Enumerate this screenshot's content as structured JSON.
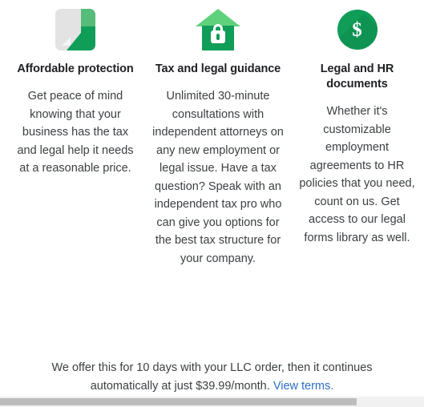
{
  "cards": [
    {
      "icon": "document-folded-corner-icon",
      "title": "Affordable protection",
      "body": "Get peace of mind knowing that your business has the tax and legal help it needs at a reasonable price."
    },
    {
      "icon": "house-with-padlock-icon",
      "title": "Tax and legal guidance",
      "body": "Unlimited 30-minute consultations with independent attorneys on any new employment or legal issue. Have a tax question? Speak with an independent tax pro who can give you options for the best tax structure for your company."
    },
    {
      "icon": "dollar-circle-icon",
      "title": "Legal and HR documents",
      "body": "Whether it's customizable employment agreements to HR policies that you need, count on us. Get access to our legal forms library as well."
    }
  ],
  "footer": {
    "text": "We offer this for 10 days with your LLC order, then it continues automatically at just $39.99/month.",
    "link_label": "View terms.",
    "dollar_glyph": "$"
  },
  "colors": {
    "brand_green": "#0f9d58",
    "light_green": "#5fd17c",
    "link_blue": "#2b6fc3",
    "text": "#3c4043",
    "scrollbar_thumb": "#bdbdbd",
    "scrollbar_track": "#f1f1f1"
  }
}
